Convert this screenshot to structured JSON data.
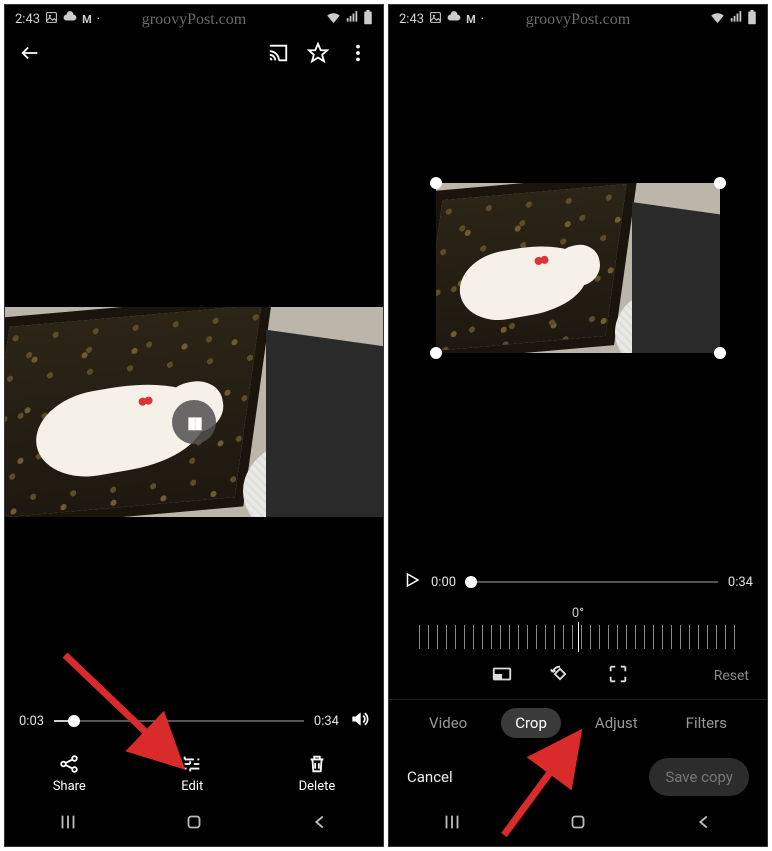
{
  "watermark": "groovyPost.com",
  "status": {
    "time": "2:43"
  },
  "left": {
    "scrubber": {
      "current": "0:03",
      "total": "0:34",
      "percent": 8
    },
    "actions": {
      "share": "Share",
      "edit": "Edit",
      "delete": "Delete"
    }
  },
  "right": {
    "scrubber": {
      "current": "0:00",
      "total": "0:34",
      "percent": 2
    },
    "rotation_label": "0°",
    "reset_label": "Reset",
    "tabs": {
      "video": "Video",
      "crop": "Crop",
      "adjust": "Adjust",
      "filters": "Filters"
    },
    "footer": {
      "cancel": "Cancel",
      "save": "Save copy"
    }
  }
}
